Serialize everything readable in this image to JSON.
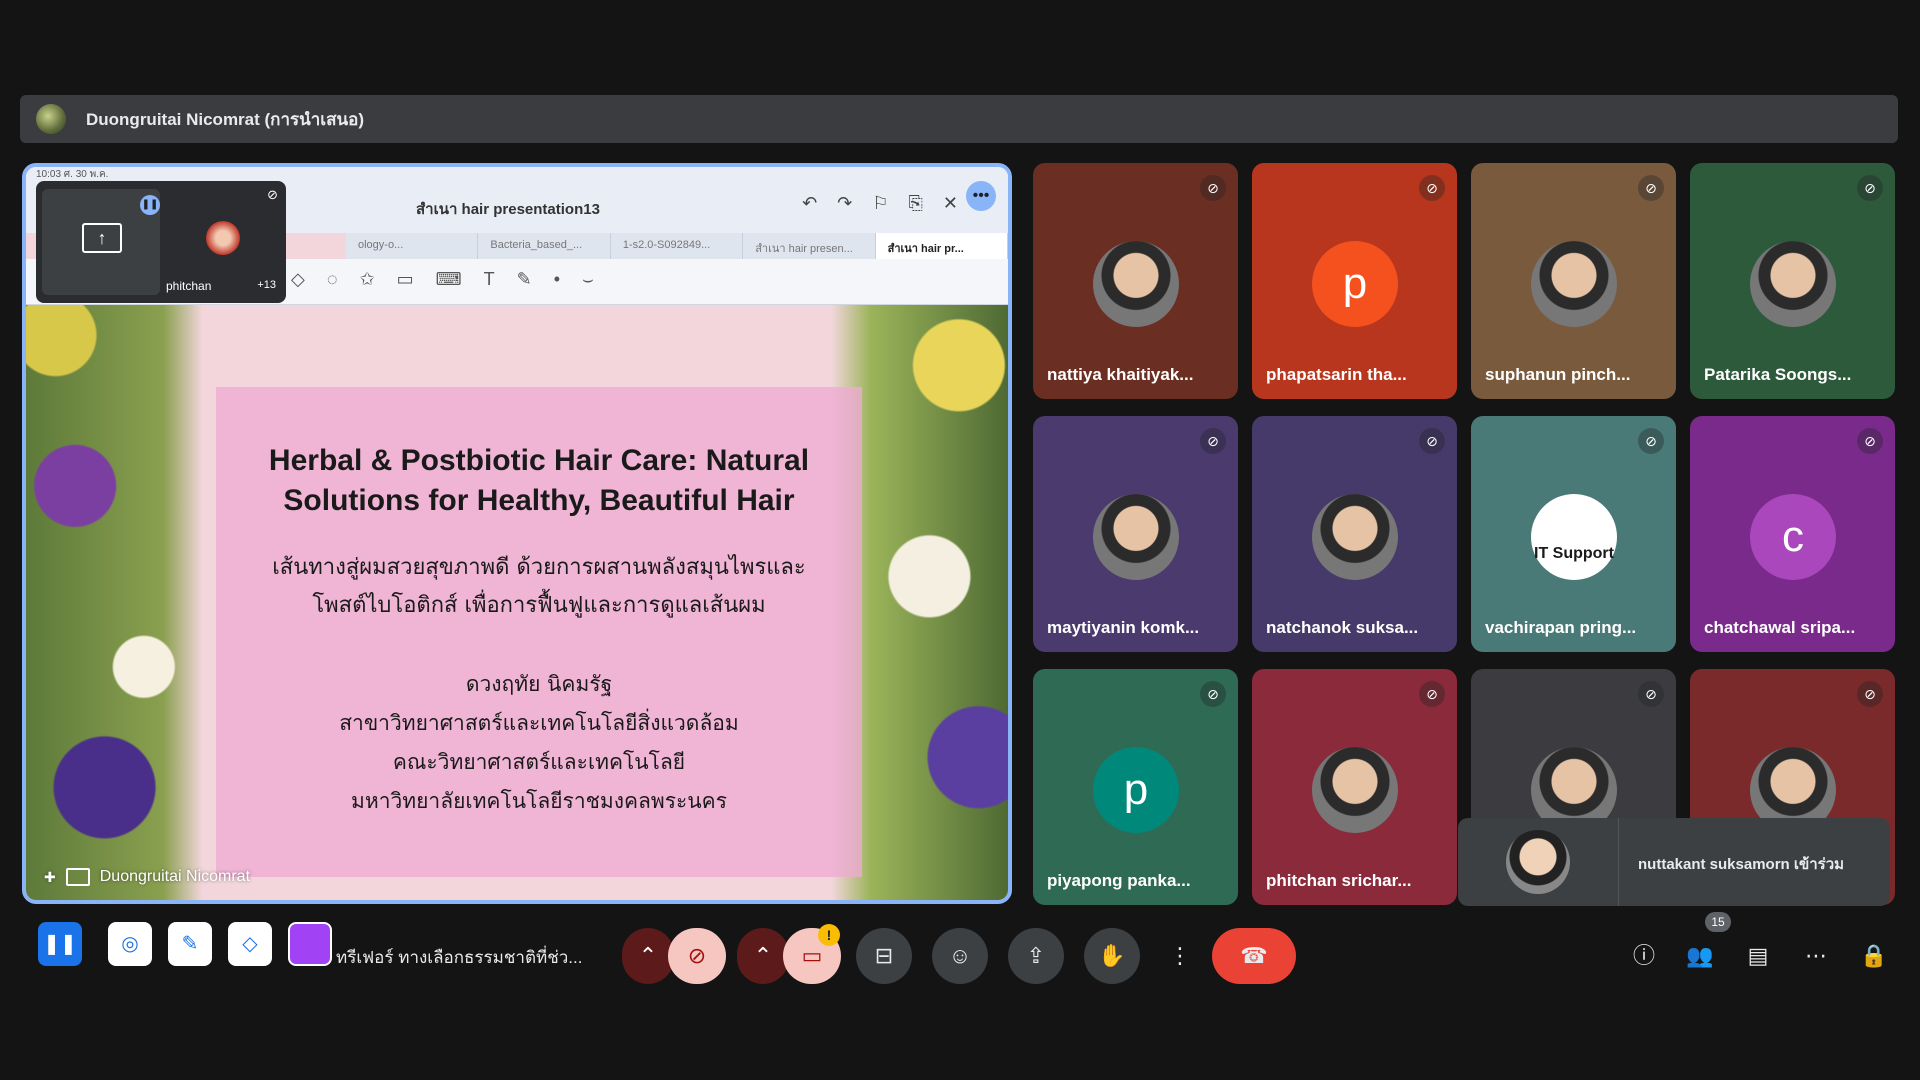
{
  "presenter_bar": {
    "title": "Duongruitai Nicomrat (การนำเสนอ)"
  },
  "presentation": {
    "status_time": "10:03  ศ. 30 พ.ค.",
    "doc_title": "สำเนา hair presentation13",
    "tabs": [
      "ology-o...",
      "Bacteria_based_...",
      "1-s2.0-S092849...",
      "สำเนา hair presen...",
      "สำเนา hair pr..."
    ],
    "mini_tile": {
      "name": "phitchan",
      "count": "+13"
    },
    "slide": {
      "title": "Herbal & Postbiotic Hair Care: Natural Solutions for Healthy, Beautiful Hair",
      "subtitle_1": "เส้นทางสู่ผมสวยสุขภาพดี ด้วยการผสานพลังสมุนไพรและ",
      "subtitle_2": "โพสต์ไบโอติกส์ เพื่อการฟื้นฟูและการดูแลเส้นผม",
      "author": "ดวงฤทัย นิคมรัฐ",
      "department": "สาขาวิทยาศาสตร์และเทคโนโลยีสิ่งแวดล้อม",
      "faculty": "คณะวิทยาศาสตร์และเทคโนโลยี",
      "university": "มหาวิทยาลัยเทคโนโลยีราชมงคลพระนคร"
    },
    "presenter_label": "Duongruitai Nicomrat"
  },
  "participants": [
    {
      "name": "nattiya khaitiyak...",
      "avatar": "photo",
      "color": "#6b2e22"
    },
    {
      "name": "phapatsarin tha...",
      "avatar": "p",
      "color": "#b8361e"
    },
    {
      "name": "suphanun pinch...",
      "avatar": "photo",
      "color": "#7a5a3c"
    },
    {
      "name": "Patarika Soongs...",
      "avatar": "photo",
      "color": "#2e5a3c"
    },
    {
      "name": "maytiyanin komk...",
      "avatar": "photo",
      "color": "#4a3a6e"
    },
    {
      "name": "natchanok suksa...",
      "avatar": "photo",
      "color": "#463a6a"
    },
    {
      "name": "vachirapan pring...",
      "avatar": "IT Support",
      "color": "#4a7a78"
    },
    {
      "name": "chatchawal sripa...",
      "avatar": "c",
      "color": "#7a2a8a"
    },
    {
      "name": "piyapong panka...",
      "avatar": "p",
      "color": "#2f6a54"
    },
    {
      "name": "phitchan srichar...",
      "avatar": "photo",
      "color": "#8a2a3a"
    },
    {
      "name": "",
      "avatar": "photo",
      "color": "#3c3c40"
    },
    {
      "name": "",
      "avatar": "photo",
      "color": "#7a2a2a"
    }
  ],
  "join_toast": {
    "text": "nuttakant suksamorn เข้าร่วม"
  },
  "bottom_bar": {
    "scroll_text": "ทรีเฟอร์ ทางเลือกธรรมชาติที่ช่ว...",
    "people_count": "15"
  }
}
